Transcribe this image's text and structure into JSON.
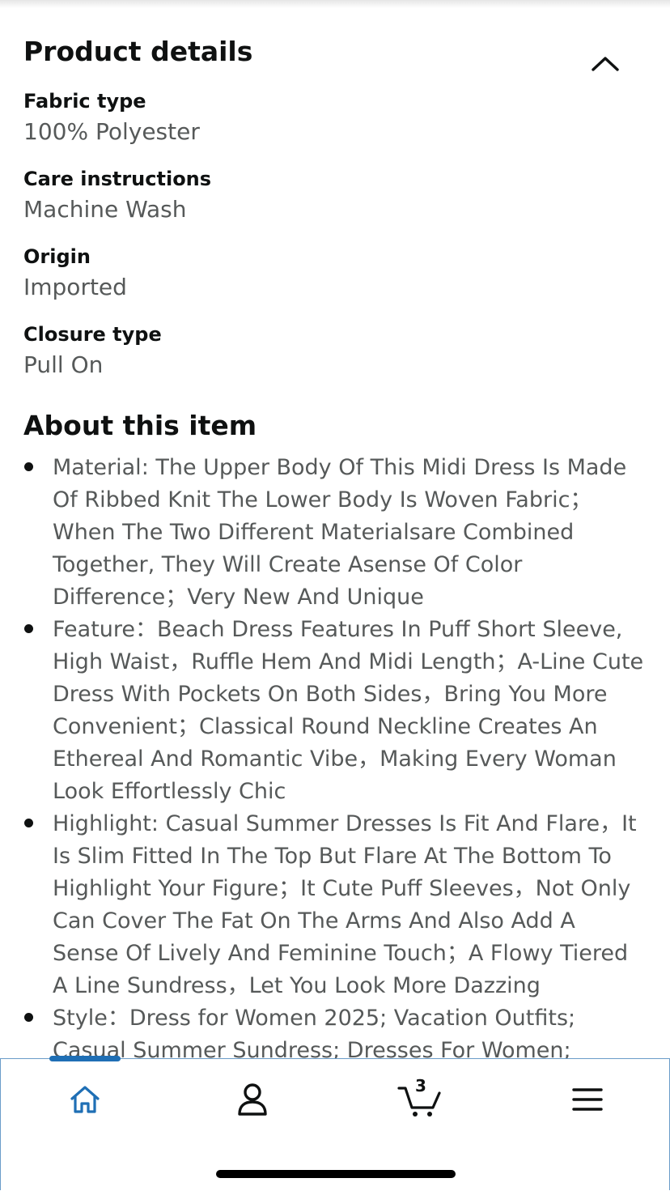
{
  "product_details": {
    "title": "Product details",
    "collapse_icon": "chevron-up-icon",
    "rows": [
      {
        "label": "Fabric type",
        "value": "100% Polyester"
      },
      {
        "label": "Care instructions",
        "value": "Machine Wash"
      },
      {
        "label": "Origin",
        "value": "Imported"
      },
      {
        "label": "Closure type",
        "value": "Pull On"
      }
    ]
  },
  "about": {
    "title": "About this item",
    "bullets": [
      "Material: The Upper Body Of This Midi Dress Is Made Of Ribbed Knit The Lower Body Is Woven Fabric；When The Two Different Materialsare Combined Together, They Will Create Asense Of Color Difference；Very New And Unique",
      "Feature：Beach Dress Features In Puff Short Sleeve, High Waist，Ruffle Hem And Midi Length；A-Line Cute Dress With Pockets On Both Sides，Bring You More Convenient；Classical Round Neckline Creates An Ethereal And Romantic Vibe，Making Every Woman Look Effortlessly Chic",
      "Highlight: Casual Summer Dresses Is Fit And Flare，It Is Slim Fitted In The Top But Flare At The Bottom To Highlight Your Figure；It Cute Puff Sleeves，Not Only Can Cover The Fat On The Arms And Also Add A Sense Of Lively And Feminine Touch；A Flowy Tiered A Line Sundress，Let You Look More Dazzing",
      "Style：Dress for Women 2025; Vacation Outfits; Casual Summer Sundress; Dresses For Women;"
    ]
  },
  "bottom_nav": {
    "items": [
      {
        "icon": "home-icon",
        "active": true
      },
      {
        "icon": "account-icon",
        "active": false
      },
      {
        "icon": "cart-icon",
        "active": false,
        "count": "3"
      },
      {
        "icon": "menu-icon",
        "active": false
      }
    ]
  },
  "colors": {
    "text_primary": "#0f1111",
    "text_secondary": "#565959",
    "active_accent": "#1f6fb5",
    "nav_border": "#6a9cc9"
  }
}
